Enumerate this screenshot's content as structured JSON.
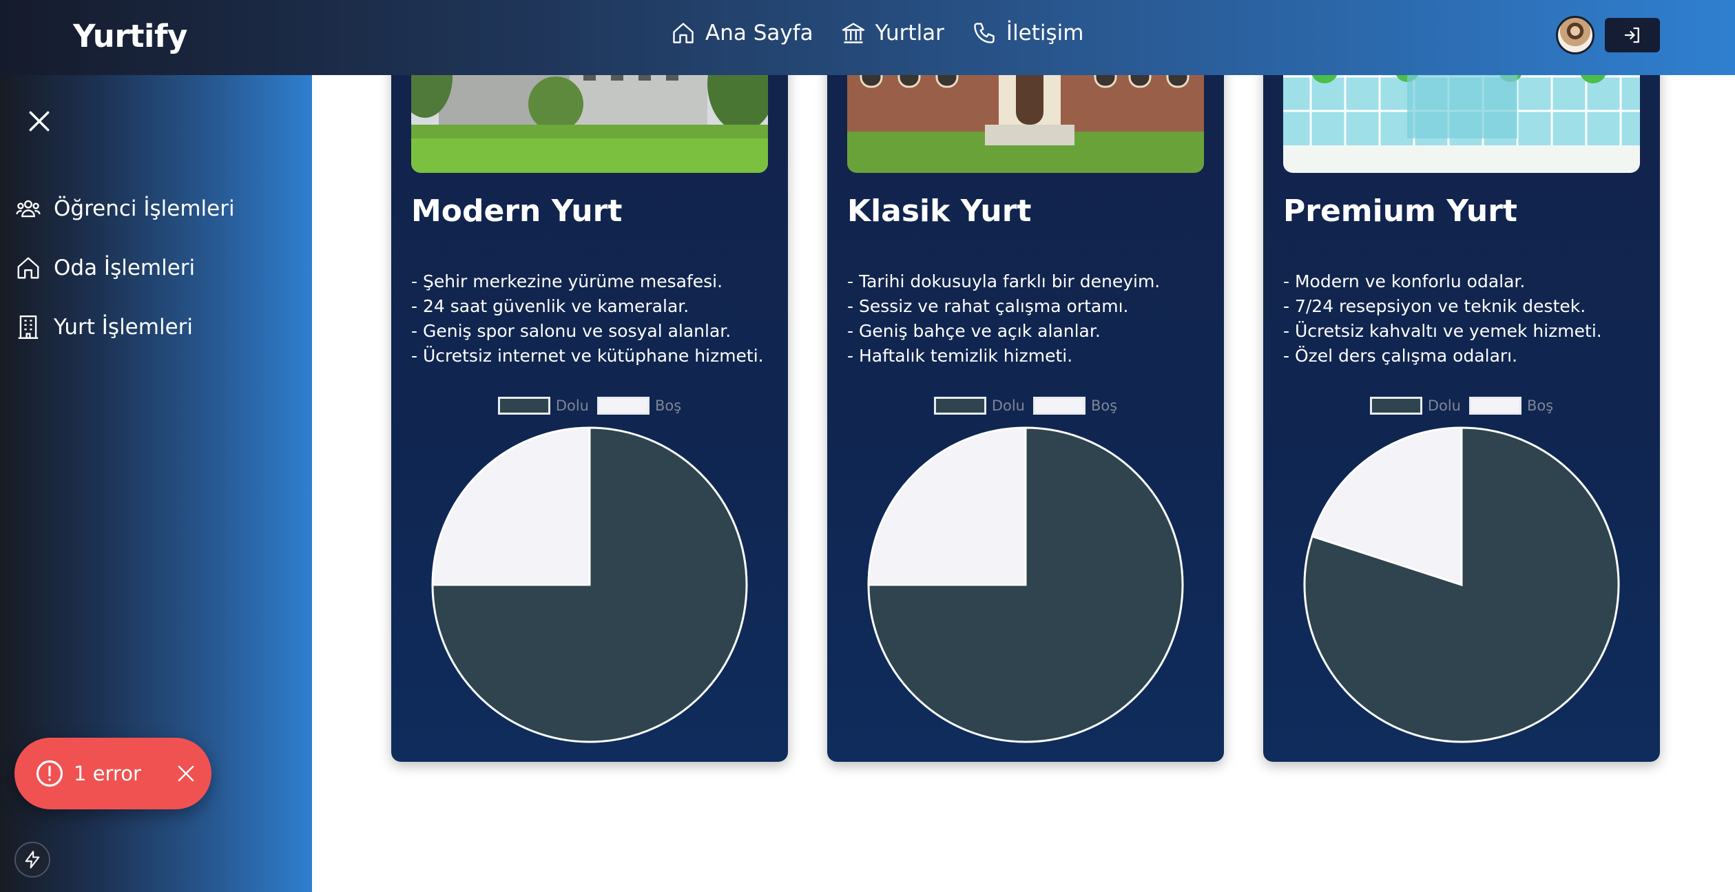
{
  "navbar": {
    "brand": "Yurtify",
    "links": [
      {
        "label": "Ana Sayfa",
        "icon": "home-icon"
      },
      {
        "label": "Yurtlar",
        "icon": "bank-icon"
      },
      {
        "label": "İletişim",
        "icon": "phone-icon"
      }
    ],
    "gradient_colors": [
      "#151b2c",
      "#2f7fd0"
    ]
  },
  "sidebar": {
    "items": [
      {
        "label": "Öğrenci İşlemleri",
        "icon": "users-icon"
      },
      {
        "label": "Oda İşlemleri",
        "icon": "home-icon"
      },
      {
        "label": "Yurt İşlemleri",
        "icon": "building-icon"
      }
    ]
  },
  "toast": {
    "text": "1 error",
    "color": "#f05252"
  },
  "legend": {
    "full": "Dolu",
    "empty": "Boş"
  },
  "colors": {
    "full": "#2f444e",
    "empty": "#f3f3f8",
    "card_bg": "#112651"
  },
  "cards": [
    {
      "title": "Modern Yurt",
      "features": [
        "- Şehir merkezine yürüme mesafesi.",
        "- 24 saat güvenlik ve kameralar.",
        "- Geniş spor salonu ve sosyal alanlar.",
        "- Ücretsiz internet ve kütüphane hizmeti."
      ]
    },
    {
      "title": "Klasik Yurt",
      "features": [
        "- Tarihi dokusuyla farklı bir deneyim.",
        "- Sessiz ve rahat çalışma ortamı.",
        "- Geniş bahçe ve açık alanlar.",
        "- Haftalık temizlik hizmeti."
      ]
    },
    {
      "title": "Premium Yurt",
      "features": [
        "- Modern ve konforlu odalar.",
        "- 7/24 resepsiyon ve teknik destek.",
        "- Ücretsiz kahvaltı ve yemek hizmeti.",
        "- Özel ders çalışma odaları."
      ]
    }
  ],
  "chart_data": [
    {
      "type": "pie",
      "categories": [
        "Dolu",
        "Boş"
      ],
      "values": [
        75,
        25
      ],
      "colors": [
        "#2f444e",
        "#f3f3f8"
      ]
    },
    {
      "type": "pie",
      "categories": [
        "Dolu",
        "Boş"
      ],
      "values": [
        75,
        25
      ],
      "colors": [
        "#2f444e",
        "#f3f3f8"
      ]
    },
    {
      "type": "pie",
      "categories": [
        "Dolu",
        "Boş"
      ],
      "values": [
        80,
        20
      ],
      "colors": [
        "#2f444e",
        "#f3f3f8"
      ]
    }
  ]
}
